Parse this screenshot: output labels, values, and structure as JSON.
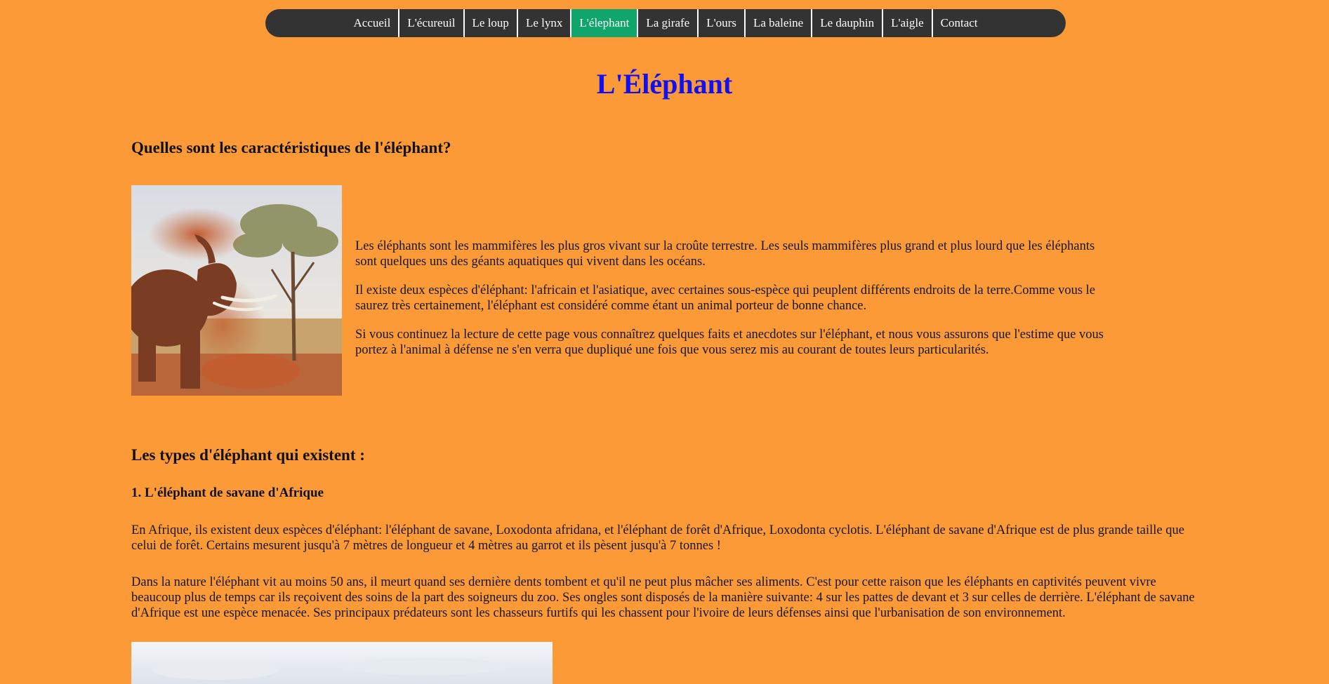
{
  "nav": {
    "items": [
      {
        "label": "Accueil"
      },
      {
        "label": "L'écureuil"
      },
      {
        "label": "Le loup"
      },
      {
        "label": "Le lynx"
      },
      {
        "label": "L'élephant"
      },
      {
        "label": "La girafe"
      },
      {
        "label": "L'ours"
      },
      {
        "label": "La baleine"
      },
      {
        "label": "Le dauphin"
      },
      {
        "label": "L'aigle"
      },
      {
        "label": "Contact"
      }
    ],
    "active_index": 4,
    "bar_color": "#333333",
    "active_color": "#10a66b"
  },
  "page": {
    "title": "L'Éléphant",
    "background_color": "#fb9a36",
    "title_color": "#1010f0"
  },
  "characteristics": {
    "heading": "Quelles sont les caractéristiques de l'éléphant?",
    "paragraphs": [
      "Les éléphants sont les mammifères les plus gros vivant sur la croûte terrestre. Les seuls mammifères plus grand et plus lourd que les éléphants sont quelques uns des géants aquatiques qui vivent dans les océans.",
      "Il existe deux espèces d'éléphant: l'africain et l'asiatique, avec certaines sous-espèce qui peuplent différents endroits de la terre.Comme vous le saurez très certainement, l'éléphant est considéré comme étant un animal porteur de bonne chance.",
      "Si vous continuez la lecture de cette page vous connaîtrez quelques faits et anecdotes sur l'éléphant, et nous vous assurons que l'estime que vous portez à l'animal à défense ne s'en verra que dupliqué une fois que vous serez mis au courant de toutes leurs particularités."
    ]
  },
  "types": {
    "heading": "Les types d'éléphant qui existent :",
    "subheading": "1. L'éléphant de savane d'Afrique",
    "paragraphs": [
      "En Afrique, ils existent deux espèces d'éléphant: l'éléphant de savane, Loxodonta afridana, et l'éléphant de forêt d'Afrique, Loxodonta cyclotis. L'éléphant de savane d'Afrique est de plus grande taille que celui de forêt. Certains mesurent jusqu'à 7 mètres de longueur et 4 mètres au garrot et ils pèsent jusqu'à 7 tonnes !",
      "Dans la nature l'éléphant vit au moins 50 ans, il meurt quand ses dernière dents tombent et qu'il ne peut plus mâcher ses aliments. C'est pour cette raison que les éléphants en captivités peuvent vivre beaucoup plus de temps car ils reçoivent des soins de la part des soigneurs du zoo. Ses ongles sont disposés de la manière suivante: 4 sur les pattes de devant et 3 sur celles de derrière. L'éléphant de savane d'Afrique est une espèce menacée. Ses principaux prédateurs sont les chasseurs furtifs qui les chassent pour l'ivoire de leurs défenses ainsi que l'urbanisation de son environnement."
    ]
  }
}
